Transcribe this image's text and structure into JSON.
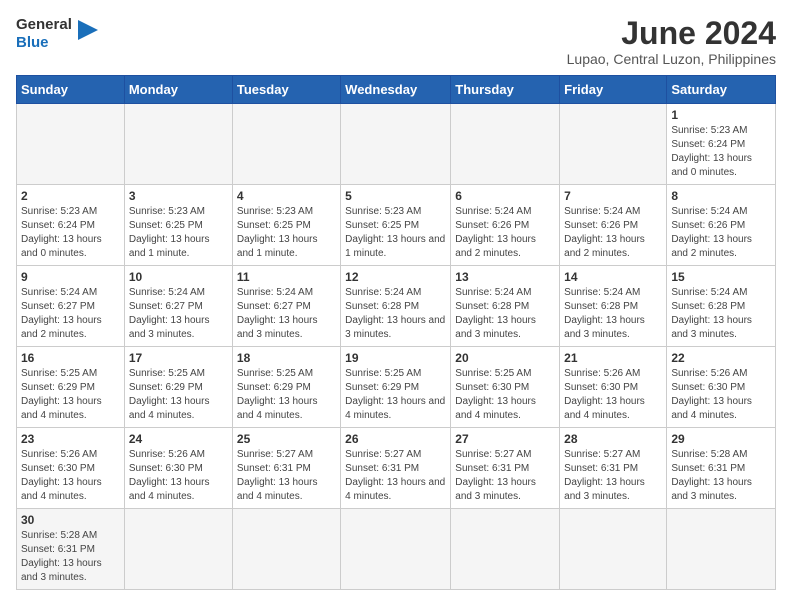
{
  "header": {
    "logo_general": "General",
    "logo_blue": "Blue",
    "month_year": "June 2024",
    "location": "Lupao, Central Luzon, Philippines"
  },
  "days_of_week": [
    "Sunday",
    "Monday",
    "Tuesday",
    "Wednesday",
    "Thursday",
    "Friday",
    "Saturday"
  ],
  "weeks": [
    [
      {
        "day": "",
        "info": "",
        "empty": true
      },
      {
        "day": "",
        "info": "",
        "empty": true
      },
      {
        "day": "",
        "info": "",
        "empty": true
      },
      {
        "day": "",
        "info": "",
        "empty": true
      },
      {
        "day": "",
        "info": "",
        "empty": true
      },
      {
        "day": "",
        "info": "",
        "empty": true
      },
      {
        "day": "1",
        "info": "Sunrise: 5:23 AM\nSunset: 6:24 PM\nDaylight: 13 hours and 0 minutes."
      }
    ],
    [
      {
        "day": "2",
        "info": "Sunrise: 5:23 AM\nSunset: 6:24 PM\nDaylight: 13 hours and 0 minutes."
      },
      {
        "day": "3",
        "info": "Sunrise: 5:23 AM\nSunset: 6:25 PM\nDaylight: 13 hours and 1 minute."
      },
      {
        "day": "4",
        "info": "Sunrise: 5:23 AM\nSunset: 6:25 PM\nDaylight: 13 hours and 1 minute."
      },
      {
        "day": "5",
        "info": "Sunrise: 5:23 AM\nSunset: 6:25 PM\nDaylight: 13 hours and 1 minute."
      },
      {
        "day": "6",
        "info": "Sunrise: 5:24 AM\nSunset: 6:26 PM\nDaylight: 13 hours and 2 minutes."
      },
      {
        "day": "7",
        "info": "Sunrise: 5:24 AM\nSunset: 6:26 PM\nDaylight: 13 hours and 2 minutes."
      },
      {
        "day": "8",
        "info": "Sunrise: 5:24 AM\nSunset: 6:26 PM\nDaylight: 13 hours and 2 minutes."
      }
    ],
    [
      {
        "day": "9",
        "info": "Sunrise: 5:24 AM\nSunset: 6:27 PM\nDaylight: 13 hours and 2 minutes."
      },
      {
        "day": "10",
        "info": "Sunrise: 5:24 AM\nSunset: 6:27 PM\nDaylight: 13 hours and 3 minutes."
      },
      {
        "day": "11",
        "info": "Sunrise: 5:24 AM\nSunset: 6:27 PM\nDaylight: 13 hours and 3 minutes."
      },
      {
        "day": "12",
        "info": "Sunrise: 5:24 AM\nSunset: 6:28 PM\nDaylight: 13 hours and 3 minutes."
      },
      {
        "day": "13",
        "info": "Sunrise: 5:24 AM\nSunset: 6:28 PM\nDaylight: 13 hours and 3 minutes."
      },
      {
        "day": "14",
        "info": "Sunrise: 5:24 AM\nSunset: 6:28 PM\nDaylight: 13 hours and 3 minutes."
      },
      {
        "day": "15",
        "info": "Sunrise: 5:24 AM\nSunset: 6:28 PM\nDaylight: 13 hours and 3 minutes."
      }
    ],
    [
      {
        "day": "16",
        "info": "Sunrise: 5:25 AM\nSunset: 6:29 PM\nDaylight: 13 hours and 4 minutes."
      },
      {
        "day": "17",
        "info": "Sunrise: 5:25 AM\nSunset: 6:29 PM\nDaylight: 13 hours and 4 minutes."
      },
      {
        "day": "18",
        "info": "Sunrise: 5:25 AM\nSunset: 6:29 PM\nDaylight: 13 hours and 4 minutes."
      },
      {
        "day": "19",
        "info": "Sunrise: 5:25 AM\nSunset: 6:29 PM\nDaylight: 13 hours and 4 minutes."
      },
      {
        "day": "20",
        "info": "Sunrise: 5:25 AM\nSunset: 6:30 PM\nDaylight: 13 hours and 4 minutes."
      },
      {
        "day": "21",
        "info": "Sunrise: 5:26 AM\nSunset: 6:30 PM\nDaylight: 13 hours and 4 minutes."
      },
      {
        "day": "22",
        "info": "Sunrise: 5:26 AM\nSunset: 6:30 PM\nDaylight: 13 hours and 4 minutes."
      }
    ],
    [
      {
        "day": "23",
        "info": "Sunrise: 5:26 AM\nSunset: 6:30 PM\nDaylight: 13 hours and 4 minutes."
      },
      {
        "day": "24",
        "info": "Sunrise: 5:26 AM\nSunset: 6:30 PM\nDaylight: 13 hours and 4 minutes."
      },
      {
        "day": "25",
        "info": "Sunrise: 5:27 AM\nSunset: 6:31 PM\nDaylight: 13 hours and 4 minutes."
      },
      {
        "day": "26",
        "info": "Sunrise: 5:27 AM\nSunset: 6:31 PM\nDaylight: 13 hours and 4 minutes."
      },
      {
        "day": "27",
        "info": "Sunrise: 5:27 AM\nSunset: 6:31 PM\nDaylight: 13 hours and 3 minutes."
      },
      {
        "day": "28",
        "info": "Sunrise: 5:27 AM\nSunset: 6:31 PM\nDaylight: 13 hours and 3 minutes."
      },
      {
        "day": "29",
        "info": "Sunrise: 5:28 AM\nSunset: 6:31 PM\nDaylight: 13 hours and 3 minutes."
      }
    ],
    [
      {
        "day": "30",
        "info": "Sunrise: 5:28 AM\nSunset: 6:31 PM\nDaylight: 13 hours and 3 minutes.",
        "last_row": true
      },
      {
        "day": "",
        "info": "",
        "empty": true,
        "last_row": true
      },
      {
        "day": "",
        "info": "",
        "empty": true,
        "last_row": true
      },
      {
        "day": "",
        "info": "",
        "empty": true,
        "last_row": true
      },
      {
        "day": "",
        "info": "",
        "empty": true,
        "last_row": true
      },
      {
        "day": "",
        "info": "",
        "empty": true,
        "last_row": true
      },
      {
        "day": "",
        "info": "",
        "empty": true,
        "last_row": true
      }
    ]
  ]
}
